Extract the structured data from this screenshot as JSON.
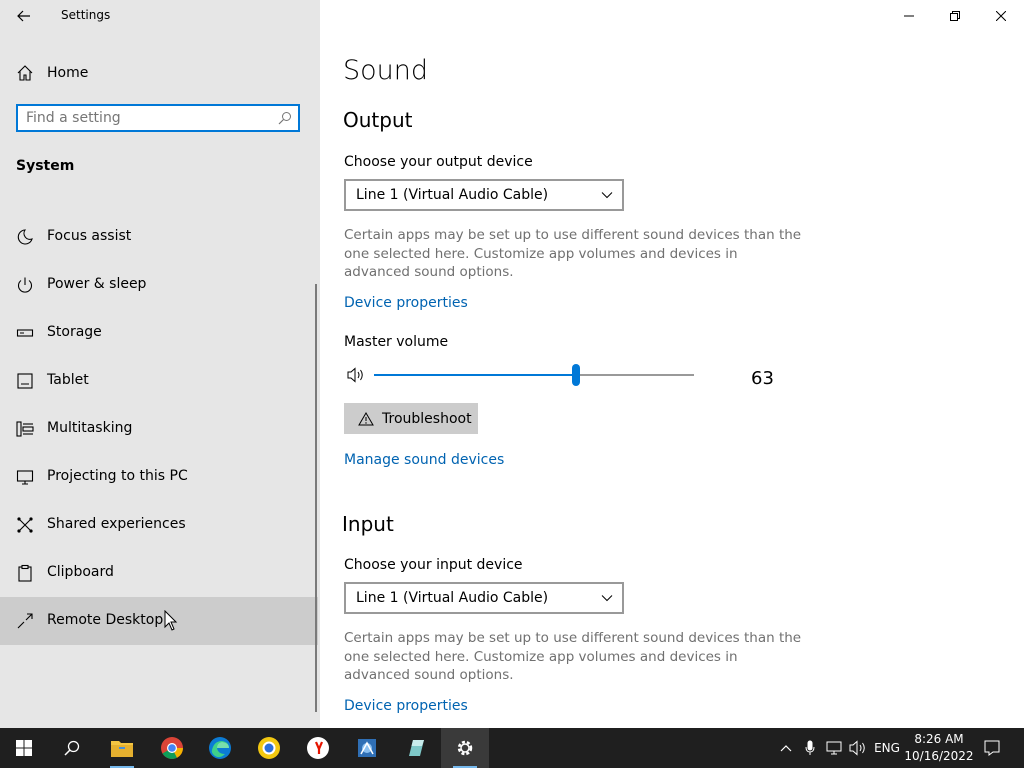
{
  "window": {
    "title": "Settings"
  },
  "sidebar": {
    "home_label": "Home",
    "search_placeholder": "Find a setting",
    "section": "System",
    "items": [
      {
        "label": "Focus assist",
        "icon": "moon-icon"
      },
      {
        "label": "Power & sleep",
        "icon": "power-icon"
      },
      {
        "label": "Storage",
        "icon": "storage-icon"
      },
      {
        "label": "Tablet",
        "icon": "tablet-icon"
      },
      {
        "label": "Multitasking",
        "icon": "multitasking-icon"
      },
      {
        "label": "Projecting to this PC",
        "icon": "projecting-icon"
      },
      {
        "label": "Shared experiences",
        "icon": "shared-experiences-icon"
      },
      {
        "label": "Clipboard",
        "icon": "clipboard-icon"
      },
      {
        "label": "Remote Desktop",
        "icon": "remote-desktop-icon",
        "selected": true
      }
    ]
  },
  "main": {
    "page_title": "Sound",
    "output": {
      "heading": "Output",
      "device_label": "Choose your output device",
      "device_value": "Line 1 (Virtual Audio Cable)",
      "help_text": "Certain apps may be set up to use different sound devices than the one selected here. Customize app volumes and devices in advanced sound options.",
      "device_properties_link": "Device properties",
      "master_volume_label": "Master volume",
      "volume": 63,
      "volume_text": "63",
      "troubleshoot_label": "Troubleshoot",
      "manage_link": "Manage sound devices"
    },
    "input": {
      "heading": "Input",
      "device_label": "Choose your input device",
      "device_value": "Line 1 (Virtual Audio Cable)",
      "help_text": "Certain apps may be set up to use different sound devices than the one selected here. Customize app volumes and devices in advanced sound options.",
      "device_properties_link": "Device properties"
    }
  },
  "taskbar": {
    "language": "ENG",
    "time": "8:26 AM",
    "date": "10/16/2022",
    "accent_color": "#0078d7"
  }
}
